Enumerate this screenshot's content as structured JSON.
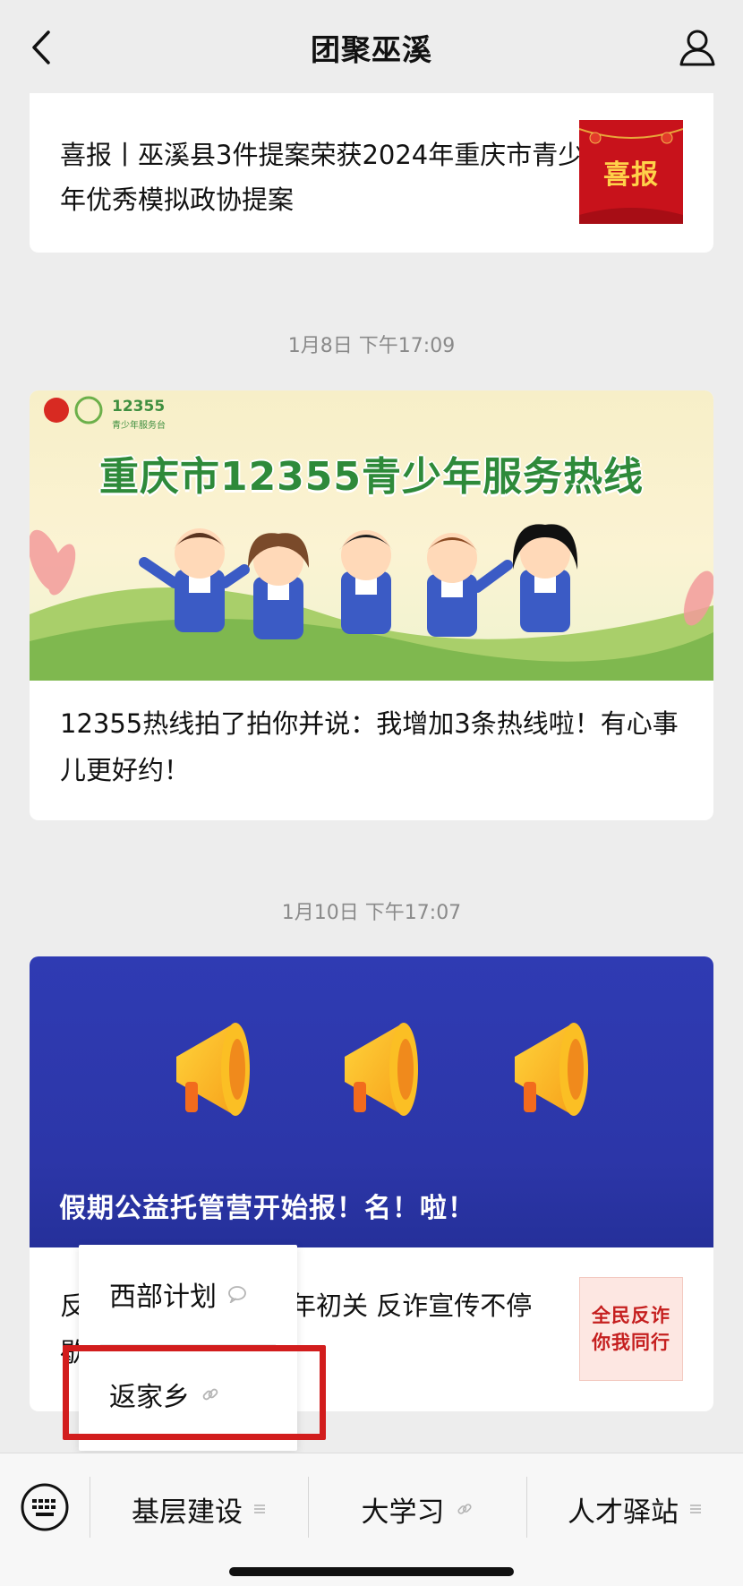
{
  "header": {
    "title": "团聚巫溪"
  },
  "articles": [
    {
      "text": "喜报丨巫溪县3件提案荣获2024年重庆市青少年优秀模拟政协提案",
      "thumb_text": "喜报"
    },
    {
      "timestamp": "1月8日 下午17:09",
      "banner_headline": "重庆市12355青少年服务热线",
      "banner_logo": "12355",
      "banner_logo_sub": "青少年服务台",
      "text": "12355热线拍了拍你并说：我增加3条热线啦！有心事儿更好约！"
    },
    {
      "timestamp": "1月10日 下午17:07",
      "banner_caption": "假期公益托管营开始报！名！啦！",
      "text_visible": "反",
      "text_right": "年初关 反诈宣传不停",
      "text_line2": "歇",
      "thumb_line1": "全民反诈",
      "thumb_line2": "你我同行"
    }
  ],
  "submenu": {
    "items": [
      {
        "label": "西部计划",
        "icon": "chat-bubble-icon"
      },
      {
        "label": "返家乡",
        "icon": "link-icon"
      }
    ]
  },
  "bottom_menu": {
    "tabs": [
      {
        "label": "基层建设",
        "icon": "menu-lines-icon"
      },
      {
        "label": "大学习",
        "icon": "link-icon"
      },
      {
        "label": "人才驿站",
        "icon": "menu-lines-icon"
      }
    ]
  },
  "colors": {
    "highlight": "#d21d1d",
    "banner_blue": "#2f3bb3",
    "headline_green": "#2e8a3a"
  }
}
